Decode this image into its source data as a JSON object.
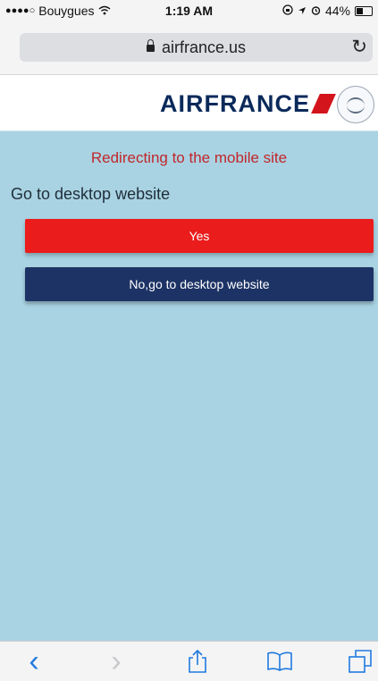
{
  "status_bar": {
    "signal": "●●●●○",
    "carrier": "Bouygues",
    "wifi_icon": "wifi-icon",
    "time": "1:19 AM",
    "battery_percent": "44%"
  },
  "browser": {
    "url": "airfrance.us",
    "lock_icon": "lock-icon",
    "reload_icon": "reload-icon"
  },
  "header": {
    "brand": "AIRFRANCE"
  },
  "content": {
    "redirect_message": "Redirecting to the mobile site",
    "desktop_prompt": "Go to desktop website",
    "yes_label": "Yes",
    "no_label": "No,go to desktop website"
  },
  "colors": {
    "background": "#a9d3e2",
    "redirect_text": "#c2262c",
    "yes_button": "#ea1c1c",
    "no_button": "#1d3365",
    "brand_navy": "#0b2a5b"
  },
  "toolbar": {
    "icons": [
      "back-icon",
      "forward-icon",
      "share-icon",
      "bookmarks-icon",
      "tabs-icon"
    ]
  }
}
